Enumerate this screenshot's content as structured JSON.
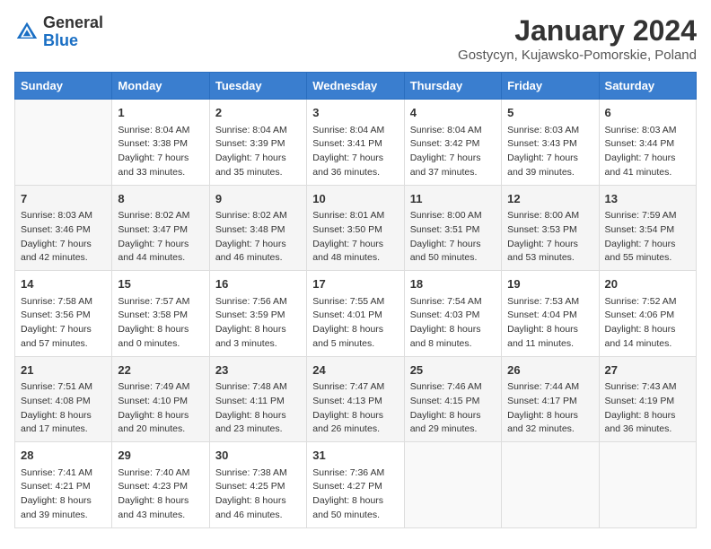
{
  "header": {
    "logo_general": "General",
    "logo_blue": "Blue",
    "month_title": "January 2024",
    "location": "Gostycyn, Kujawsko-Pomorskie, Poland"
  },
  "days_of_week": [
    "Sunday",
    "Monday",
    "Tuesday",
    "Wednesday",
    "Thursday",
    "Friday",
    "Saturday"
  ],
  "weeks": [
    [
      {
        "day": "",
        "info": ""
      },
      {
        "day": "1",
        "info": "Sunrise: 8:04 AM\nSunset: 3:38 PM\nDaylight: 7 hours\nand 33 minutes."
      },
      {
        "day": "2",
        "info": "Sunrise: 8:04 AM\nSunset: 3:39 PM\nDaylight: 7 hours\nand 35 minutes."
      },
      {
        "day": "3",
        "info": "Sunrise: 8:04 AM\nSunset: 3:41 PM\nDaylight: 7 hours\nand 36 minutes."
      },
      {
        "day": "4",
        "info": "Sunrise: 8:04 AM\nSunset: 3:42 PM\nDaylight: 7 hours\nand 37 minutes."
      },
      {
        "day": "5",
        "info": "Sunrise: 8:03 AM\nSunset: 3:43 PM\nDaylight: 7 hours\nand 39 minutes."
      },
      {
        "day": "6",
        "info": "Sunrise: 8:03 AM\nSunset: 3:44 PM\nDaylight: 7 hours\nand 41 minutes."
      }
    ],
    [
      {
        "day": "7",
        "info": "Sunrise: 8:03 AM\nSunset: 3:46 PM\nDaylight: 7 hours\nand 42 minutes."
      },
      {
        "day": "8",
        "info": "Sunrise: 8:02 AM\nSunset: 3:47 PM\nDaylight: 7 hours\nand 44 minutes."
      },
      {
        "day": "9",
        "info": "Sunrise: 8:02 AM\nSunset: 3:48 PM\nDaylight: 7 hours\nand 46 minutes."
      },
      {
        "day": "10",
        "info": "Sunrise: 8:01 AM\nSunset: 3:50 PM\nDaylight: 7 hours\nand 48 minutes."
      },
      {
        "day": "11",
        "info": "Sunrise: 8:00 AM\nSunset: 3:51 PM\nDaylight: 7 hours\nand 50 minutes."
      },
      {
        "day": "12",
        "info": "Sunrise: 8:00 AM\nSunset: 3:53 PM\nDaylight: 7 hours\nand 53 minutes."
      },
      {
        "day": "13",
        "info": "Sunrise: 7:59 AM\nSunset: 3:54 PM\nDaylight: 7 hours\nand 55 minutes."
      }
    ],
    [
      {
        "day": "14",
        "info": "Sunrise: 7:58 AM\nSunset: 3:56 PM\nDaylight: 7 hours\nand 57 minutes."
      },
      {
        "day": "15",
        "info": "Sunrise: 7:57 AM\nSunset: 3:58 PM\nDaylight: 8 hours\nand 0 minutes."
      },
      {
        "day": "16",
        "info": "Sunrise: 7:56 AM\nSunset: 3:59 PM\nDaylight: 8 hours\nand 3 minutes."
      },
      {
        "day": "17",
        "info": "Sunrise: 7:55 AM\nSunset: 4:01 PM\nDaylight: 8 hours\nand 5 minutes."
      },
      {
        "day": "18",
        "info": "Sunrise: 7:54 AM\nSunset: 4:03 PM\nDaylight: 8 hours\nand 8 minutes."
      },
      {
        "day": "19",
        "info": "Sunrise: 7:53 AM\nSunset: 4:04 PM\nDaylight: 8 hours\nand 11 minutes."
      },
      {
        "day": "20",
        "info": "Sunrise: 7:52 AM\nSunset: 4:06 PM\nDaylight: 8 hours\nand 14 minutes."
      }
    ],
    [
      {
        "day": "21",
        "info": "Sunrise: 7:51 AM\nSunset: 4:08 PM\nDaylight: 8 hours\nand 17 minutes."
      },
      {
        "day": "22",
        "info": "Sunrise: 7:49 AM\nSunset: 4:10 PM\nDaylight: 8 hours\nand 20 minutes."
      },
      {
        "day": "23",
        "info": "Sunrise: 7:48 AM\nSunset: 4:11 PM\nDaylight: 8 hours\nand 23 minutes."
      },
      {
        "day": "24",
        "info": "Sunrise: 7:47 AM\nSunset: 4:13 PM\nDaylight: 8 hours\nand 26 minutes."
      },
      {
        "day": "25",
        "info": "Sunrise: 7:46 AM\nSunset: 4:15 PM\nDaylight: 8 hours\nand 29 minutes."
      },
      {
        "day": "26",
        "info": "Sunrise: 7:44 AM\nSunset: 4:17 PM\nDaylight: 8 hours\nand 32 minutes."
      },
      {
        "day": "27",
        "info": "Sunrise: 7:43 AM\nSunset: 4:19 PM\nDaylight: 8 hours\nand 36 minutes."
      }
    ],
    [
      {
        "day": "28",
        "info": "Sunrise: 7:41 AM\nSunset: 4:21 PM\nDaylight: 8 hours\nand 39 minutes."
      },
      {
        "day": "29",
        "info": "Sunrise: 7:40 AM\nSunset: 4:23 PM\nDaylight: 8 hours\nand 43 minutes."
      },
      {
        "day": "30",
        "info": "Sunrise: 7:38 AM\nSunset: 4:25 PM\nDaylight: 8 hours\nand 46 minutes."
      },
      {
        "day": "31",
        "info": "Sunrise: 7:36 AM\nSunset: 4:27 PM\nDaylight: 8 hours\nand 50 minutes."
      },
      {
        "day": "",
        "info": ""
      },
      {
        "day": "",
        "info": ""
      },
      {
        "day": "",
        "info": ""
      }
    ]
  ]
}
